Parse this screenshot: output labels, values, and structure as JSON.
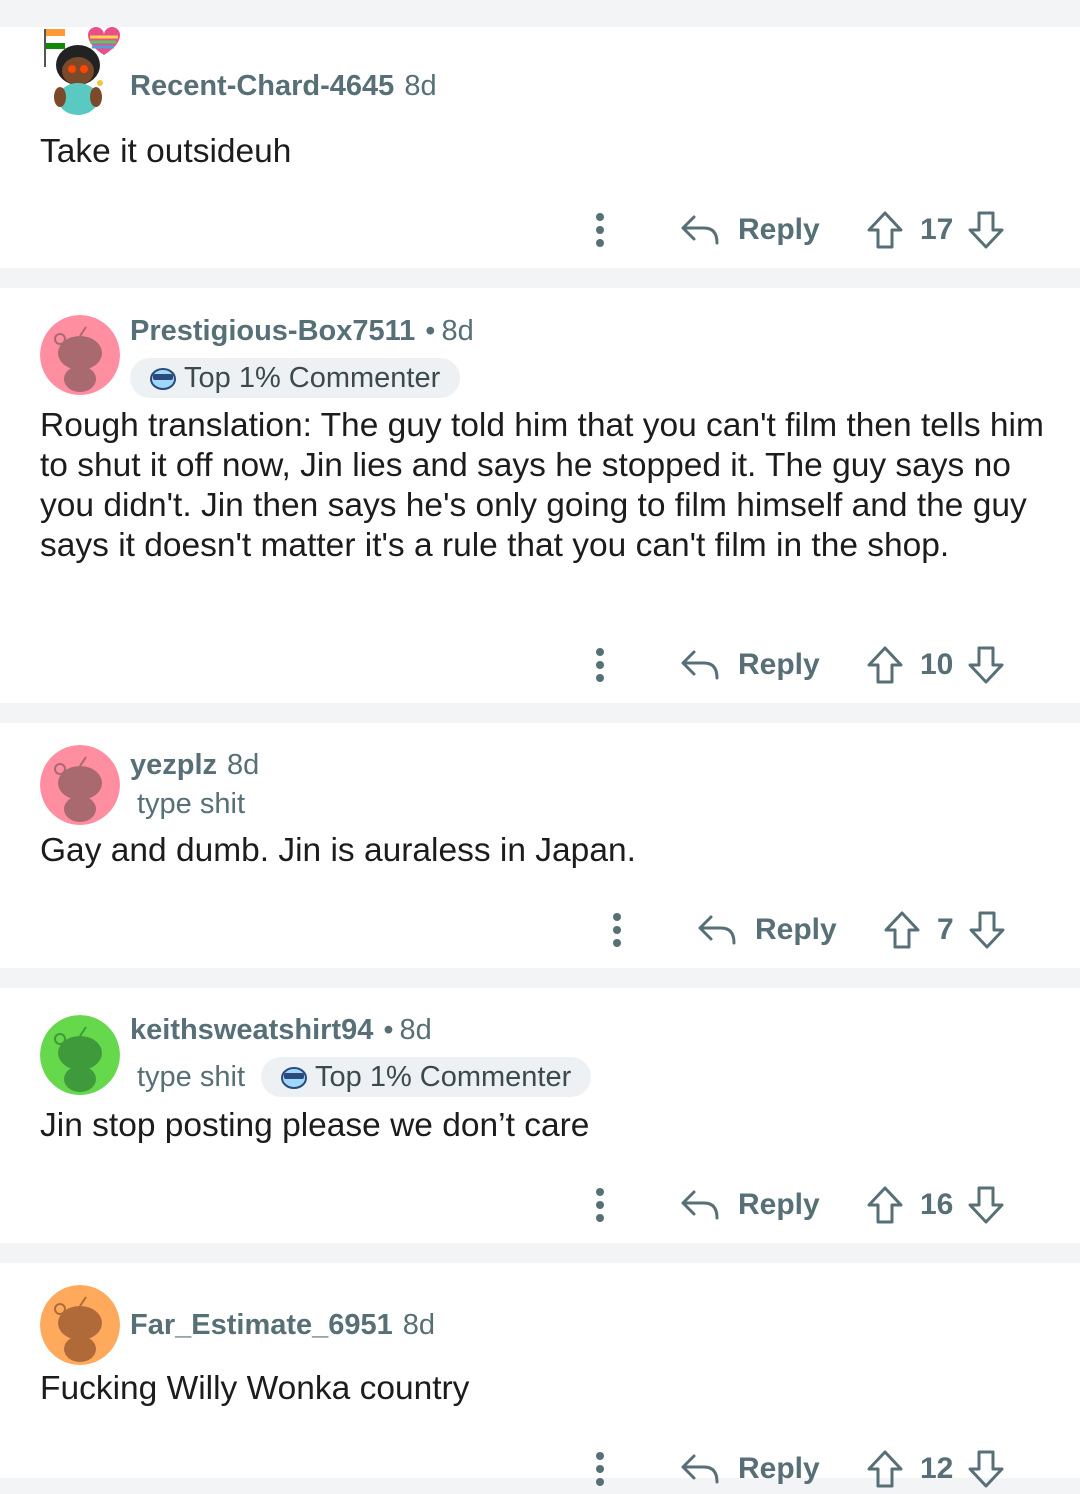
{
  "comments": [
    {
      "username": "Recent-Chard-4645",
      "time": "8d",
      "body": "Take it outsideuh",
      "reply_label": "Reply",
      "score": "17",
      "avatar_color": "#ffffff"
    },
    {
      "username": "Prestigious-Box7511",
      "separator": "•",
      "time": "8d",
      "badge": "Top 1% Commenter",
      "body": "Rough translation: The guy told him that you can't film then tells him to shut it off now, Jin lies and says he stopped it. The guy says no you didn't. Jin then says he's only going to film himself and the guy says it doesn't matter it's a rule that you can't film in the shop.",
      "reply_label": "Reply",
      "score": "10",
      "avatar_color": "#ff8ea0"
    },
    {
      "username": "yezplz",
      "time": "8d",
      "flair": "type shit",
      "body": "Gay and dumb. Jin is auraless in Japan.",
      "reply_label": "Reply",
      "score": "7",
      "avatar_color": "#ff8ea0"
    },
    {
      "username": "keithsweatshirt94",
      "separator": "•",
      "time": "8d",
      "flair": "type shit",
      "badge": "Top 1% Commenter",
      "body": "Jin stop posting please we don’t care",
      "reply_label": "Reply",
      "score": "16",
      "avatar_color": "#66d84c"
    },
    {
      "username": "Far_Estimate_6951",
      "time": "8d",
      "body": "Fucking Willy Wonka country",
      "reply_label": "Reply",
      "score": "12",
      "avatar_color": "#ffa95c"
    }
  ],
  "icons": {
    "more": "more-options-icon",
    "reply": "reply-arrow-icon",
    "upvote": "upvote-arrow-icon",
    "downvote": "downvote-arrow-icon",
    "badge": "commenter-badge-icon"
  },
  "colors": {
    "page_background": "#f2f4f5",
    "card_background": "#ffffff",
    "meta_text": "#576f76"
  }
}
